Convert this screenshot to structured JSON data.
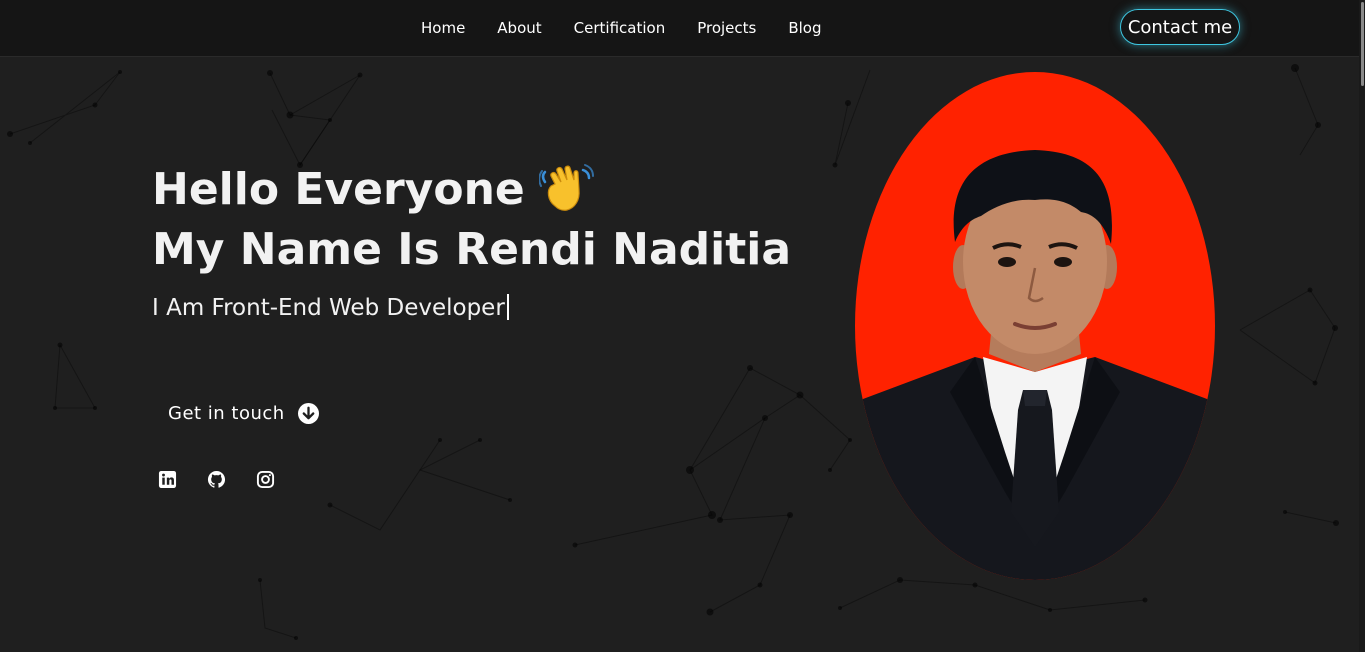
{
  "nav": {
    "links": [
      "Home",
      "About",
      "Certification",
      "Projects",
      "Blog"
    ],
    "contact_label": "Contact me"
  },
  "hero": {
    "greeting_line1": "Hello Everyone",
    "greeting_line2": "My Name Is Rendi Naditia",
    "subtitle": "I Am Front-End Web Developer",
    "cta_label": "Get in touch",
    "wave_icon": "waving-hand-emoji"
  },
  "socials": [
    {
      "name": "linkedin-icon"
    },
    {
      "name": "github-icon"
    },
    {
      "name": "instagram-icon"
    }
  ],
  "colors": {
    "background": "#1f1f1f",
    "navbar": "#151515",
    "accent_glow": "#3ec6e0",
    "photo_background": "#ff2200",
    "text": "#f2f2f2"
  }
}
